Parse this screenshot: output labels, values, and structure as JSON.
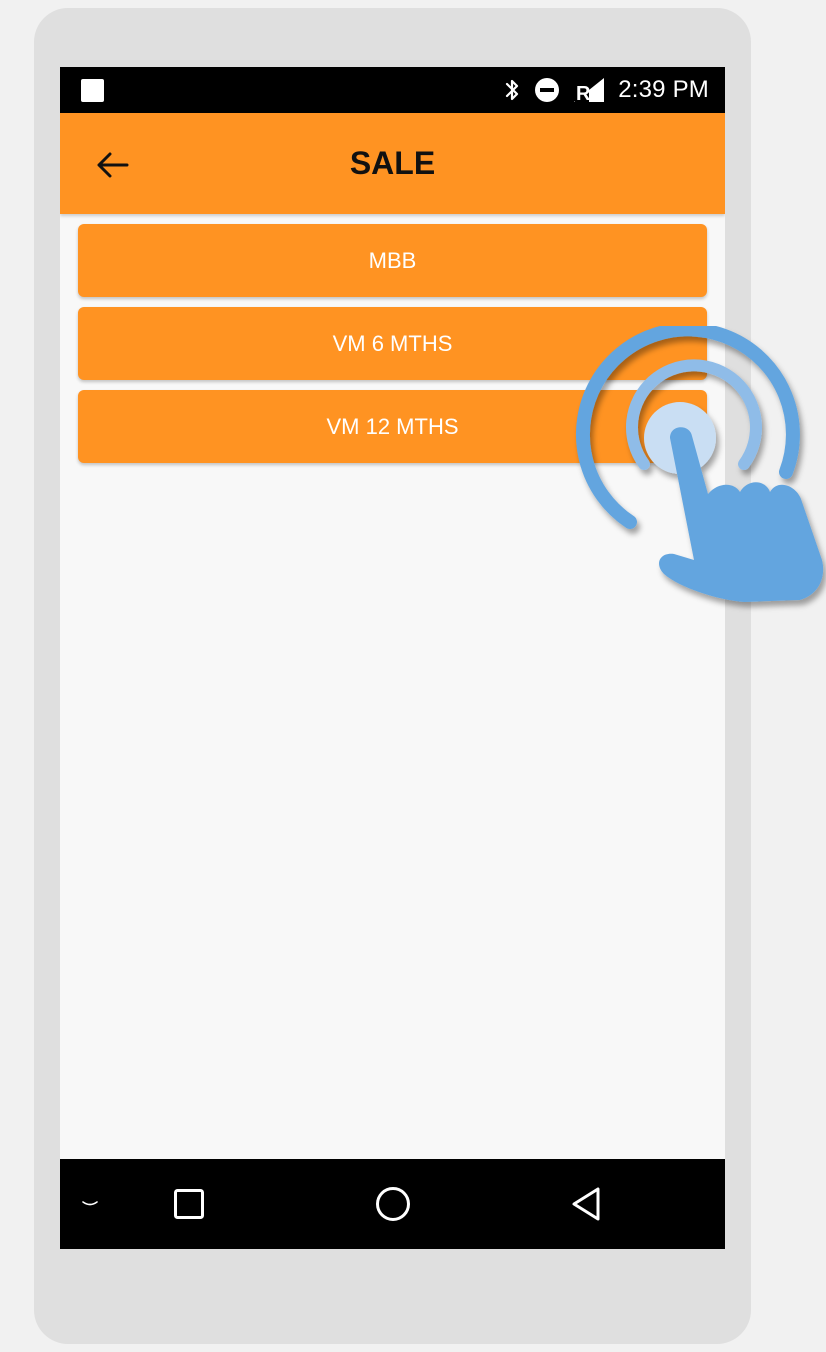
{
  "status_bar": {
    "time": "2:39 PM",
    "icons": [
      "notification-square-icon",
      "bluetooth-icon",
      "do-not-disturb-icon",
      "signal-icon"
    ]
  },
  "app_bar": {
    "title": "SALE",
    "back_icon": "arrow-left-icon"
  },
  "menu": {
    "items": [
      {
        "label": "MBB"
      },
      {
        "label": "VM 6 MTHS"
      },
      {
        "label": "VM 12 MTHS"
      }
    ]
  },
  "nav_bar": {
    "icons": [
      "chevron-down-icon",
      "recents-square-icon",
      "home-circle-icon",
      "back-triangle-icon"
    ]
  },
  "overlay": {
    "icon": "tap-hand-icon"
  },
  "colors": {
    "accent": "#ff9322",
    "device_frame": "#dfdfdf",
    "screen_bg": "#f8f8f8",
    "tap_hand": "#63a5df"
  }
}
